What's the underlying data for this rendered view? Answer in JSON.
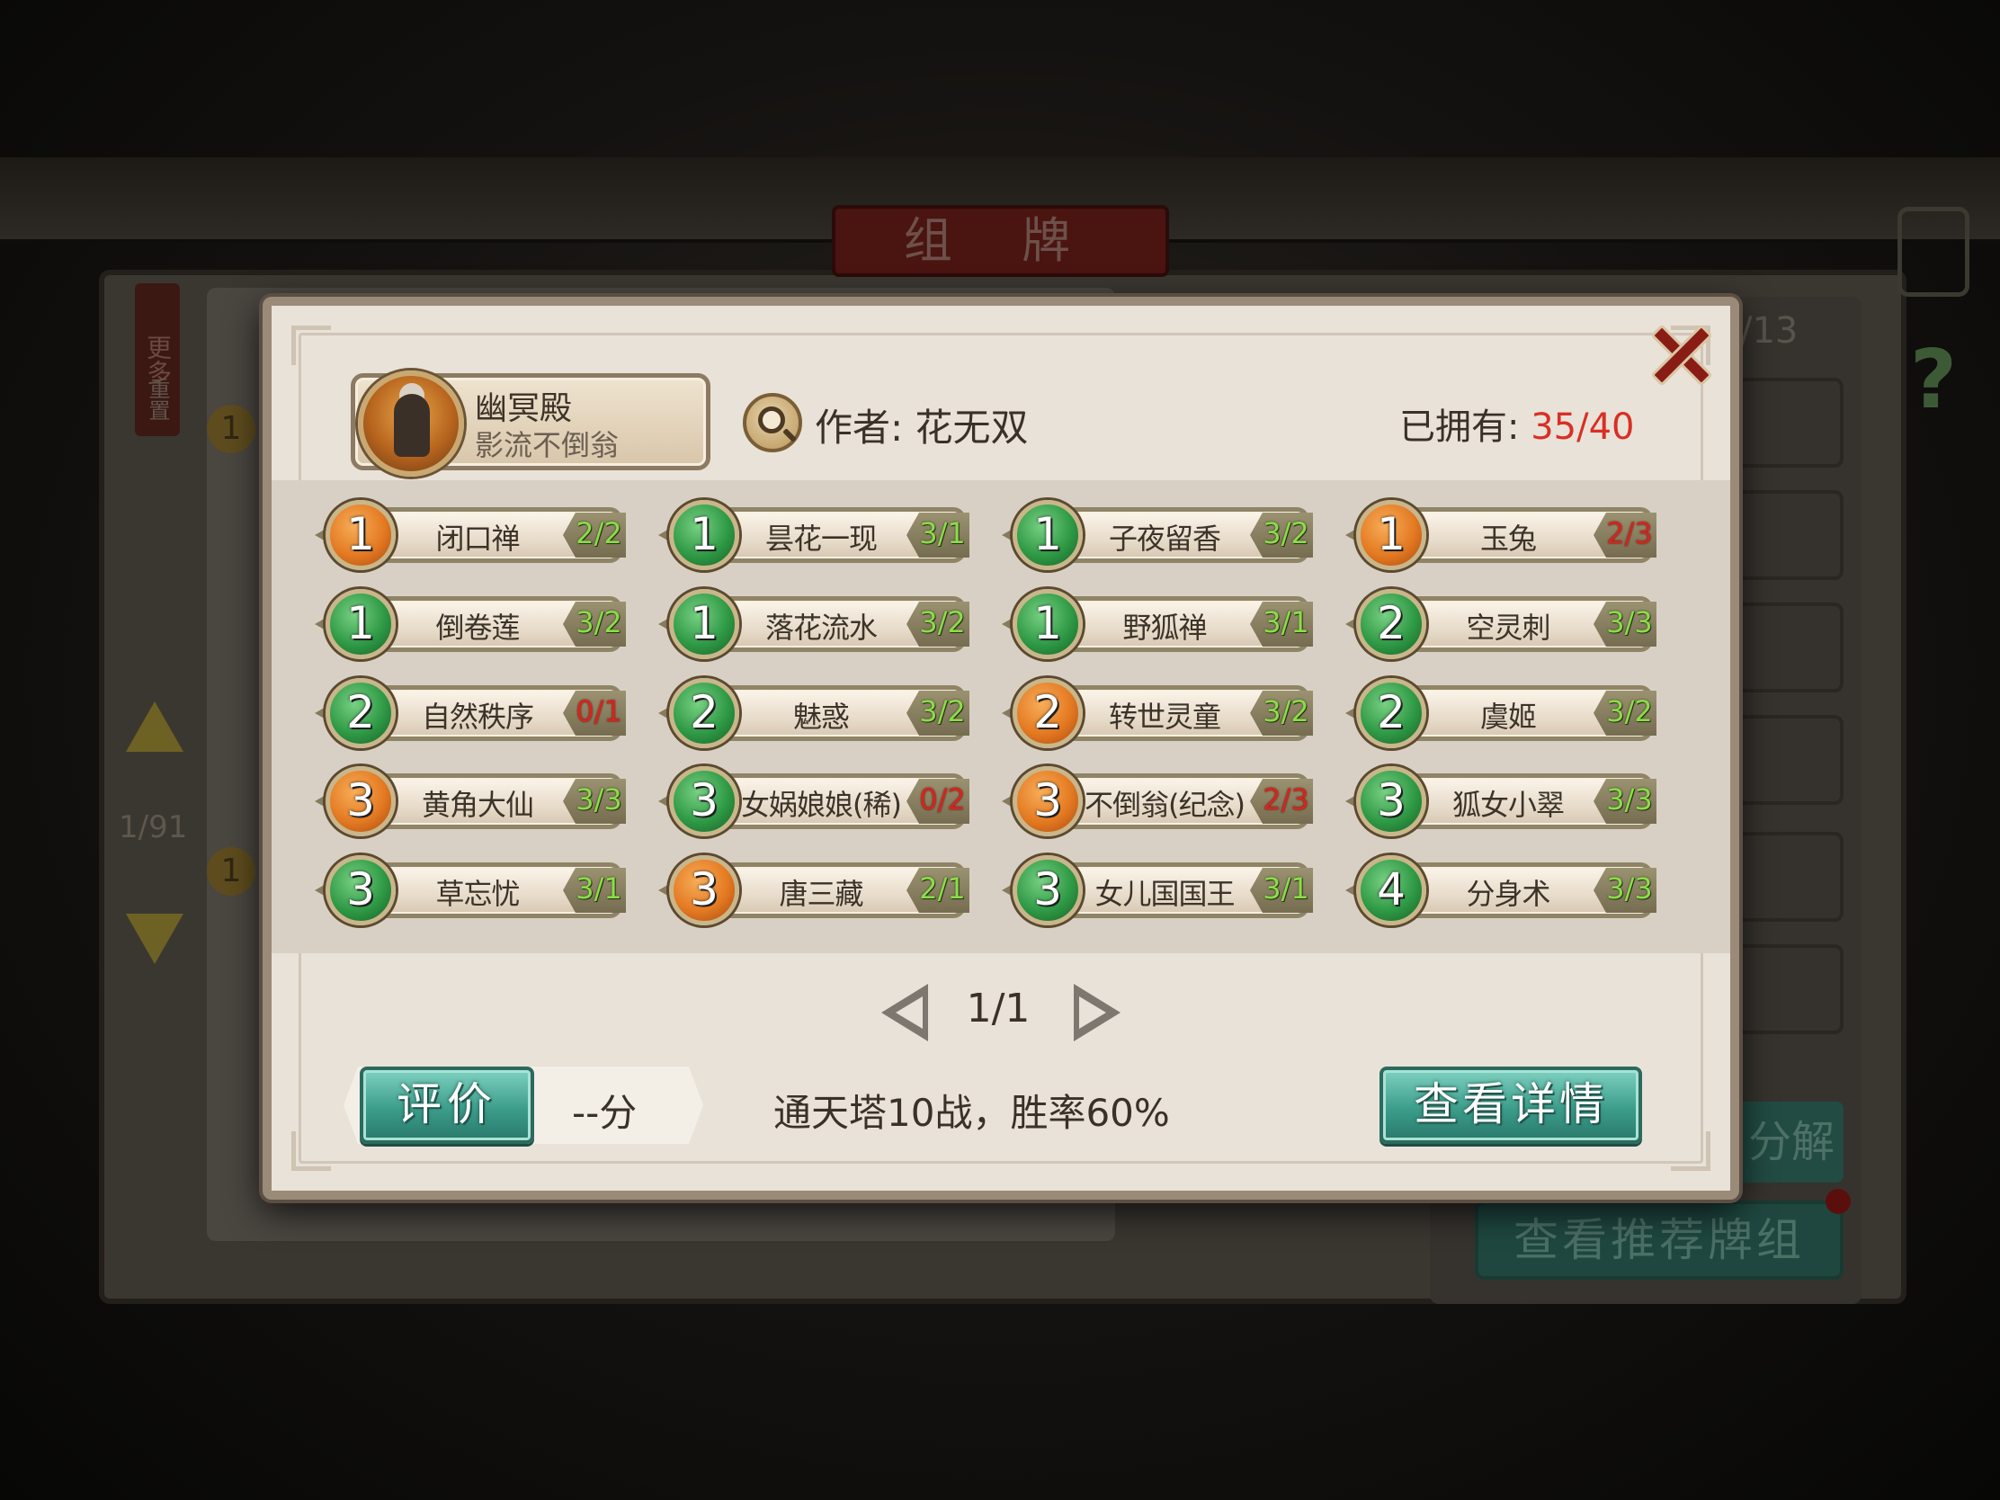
{
  "background": {
    "title": "组 牌",
    "side_tab_more": "更多",
    "side_tab_reset": "重置",
    "page_indicator": "1/91",
    "counter": "/13",
    "decompose_label": "分解",
    "recommend_button": "查看推荐牌组"
  },
  "modal": {
    "deck_name": "幽冥殿",
    "hero_name": "影流不倒翁",
    "author_label": "作者: 花无双",
    "owned_label": "已拥有: ",
    "owned_value": "35/40",
    "cards": [
      {
        "cost": "1",
        "color": "orange",
        "name": "闭口禅",
        "count": "2/2",
        "short": false
      },
      {
        "cost": "1",
        "color": "green",
        "name": "昙花一现",
        "count": "3/1",
        "short": false
      },
      {
        "cost": "1",
        "color": "green",
        "name": "子夜留香",
        "count": "3/2",
        "short": false
      },
      {
        "cost": "1",
        "color": "orange",
        "name": "玉兔",
        "count": "2/3",
        "short": true
      },
      {
        "cost": "1",
        "color": "green",
        "name": "倒卷莲",
        "count": "3/2",
        "short": false
      },
      {
        "cost": "1",
        "color": "green",
        "name": "落花流水",
        "count": "3/2",
        "short": false
      },
      {
        "cost": "1",
        "color": "green",
        "name": "野狐禅",
        "count": "3/1",
        "short": false
      },
      {
        "cost": "2",
        "color": "green",
        "name": "空灵刺",
        "count": "3/3",
        "short": false
      },
      {
        "cost": "2",
        "color": "green",
        "name": "自然秩序",
        "count": "0/1",
        "short": true
      },
      {
        "cost": "2",
        "color": "green",
        "name": "魅惑",
        "count": "3/2",
        "short": false
      },
      {
        "cost": "2",
        "color": "orange",
        "name": "转世灵童",
        "count": "3/2",
        "short": false
      },
      {
        "cost": "2",
        "color": "green",
        "name": "虞姬",
        "count": "3/2",
        "short": false
      },
      {
        "cost": "3",
        "color": "orange",
        "name": "黄角大仙",
        "count": "3/3",
        "short": false
      },
      {
        "cost": "3",
        "color": "green",
        "name": "女娲娘娘(稀)",
        "count": "0/2",
        "short": true
      },
      {
        "cost": "3",
        "color": "orange",
        "name": "不倒翁(纪念)",
        "count": "2/3",
        "short": true
      },
      {
        "cost": "3",
        "color": "green",
        "name": "狐女小翠",
        "count": "3/3",
        "short": false
      },
      {
        "cost": "3",
        "color": "green",
        "name": "草忘忧",
        "count": "3/1",
        "short": false
      },
      {
        "cost": "3",
        "color": "orange",
        "name": "唐三藏",
        "count": "2/1",
        "short": false
      },
      {
        "cost": "3",
        "color": "green",
        "name": "女儿国国王",
        "count": "3/1",
        "short": false
      },
      {
        "cost": "4",
        "color": "green",
        "name": "分身术",
        "count": "3/3",
        "short": false
      }
    ],
    "page_indicator": "1/1",
    "rate_button": "评价",
    "score": "--分",
    "record": "通天塔10战，胜率60%",
    "detail_button": "查看详情"
  },
  "colors": {
    "owned_value": "#d92f25",
    "count_ok": "#8bdc4a",
    "count_short": "#d8241c",
    "cost_orange": "#e47a22",
    "cost_green": "#2f9a46",
    "button_teal": "#3c9d8b"
  },
  "icons": [
    "hero-avatar",
    "search-icon",
    "close-icon",
    "prev-page-icon",
    "next-page-icon"
  ]
}
